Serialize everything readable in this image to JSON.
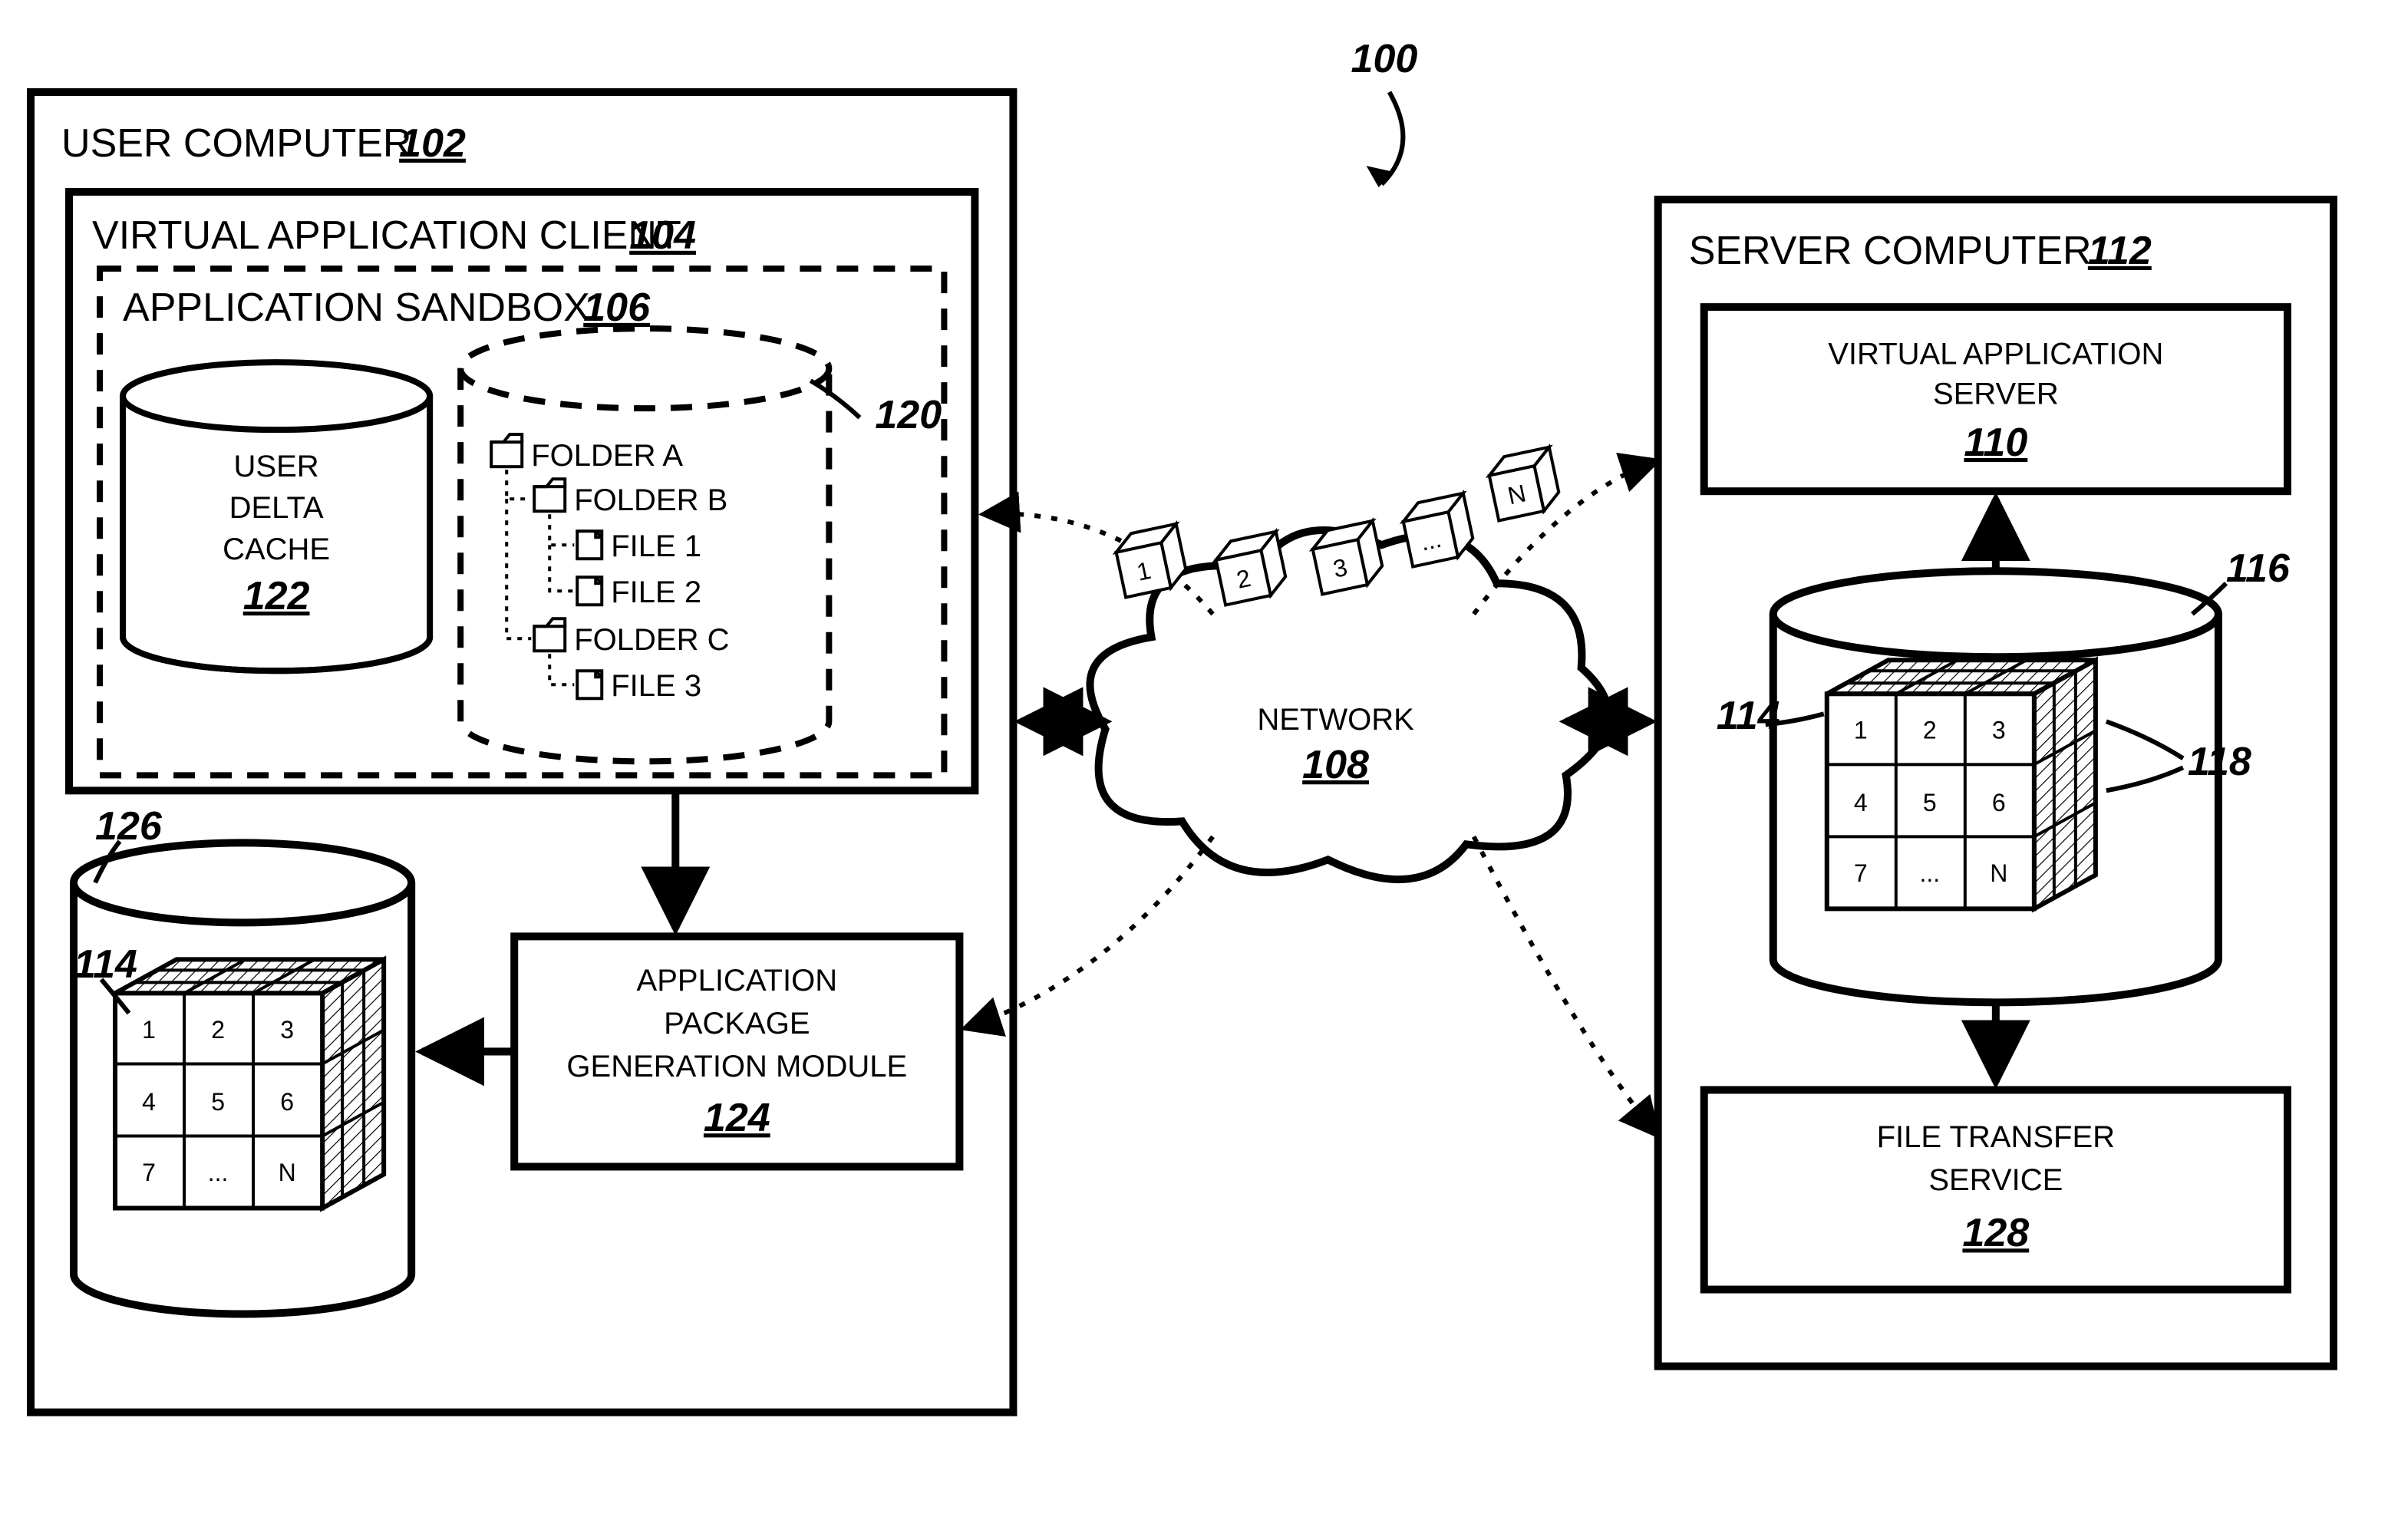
{
  "figure_ref": "100",
  "user_computer": {
    "title": "USER COMPUTER",
    "ref": "102",
    "vac": {
      "title": "VIRTUAL APPLICATION CLIENT",
      "ref": "104"
    },
    "sandbox": {
      "title": "APPLICATION SANDBOX",
      "ref": "106"
    },
    "udc": {
      "line1": "USER",
      "line2": "DELTA",
      "line3": "CACHE",
      "ref": "122"
    },
    "filetree": {
      "ref": "120",
      "folder_a": "FOLDER A",
      "folder_b": "FOLDER B",
      "file_1": "FILE 1",
      "file_2": "FILE 2",
      "folder_c": "FOLDER C",
      "file_3": "FILE 3"
    },
    "apgm": {
      "line1": "APPLICATION",
      "line2": "PACKAGE",
      "line3": "GENERATION MODULE",
      "ref": "124"
    },
    "local_db_ref": "126",
    "local_cube_ref": "114"
  },
  "network": {
    "label": "NETWORK",
    "ref": "108"
  },
  "packets": {
    "p1": "1",
    "p2": "2",
    "p3": "3",
    "p4": "...",
    "p5": "N"
  },
  "server": {
    "title": "SERVER COMPUTER",
    "ref": "112",
    "vas": {
      "line1": "VIRTUAL APPLICATION",
      "line2": "SERVER",
      "ref": "110"
    },
    "db_ref": "116",
    "cube_ref": "114",
    "slice_ref": "118",
    "fts": {
      "line1": "FILE TRANSFER",
      "line2": "SERVICE",
      "ref": "128"
    }
  },
  "cube_cells": {
    "c1": "1",
    "c2": "2",
    "c3": "3",
    "c4": "4",
    "c5": "5",
    "c6": "6",
    "c7": "7",
    "c8": "...",
    "c9": "N"
  }
}
